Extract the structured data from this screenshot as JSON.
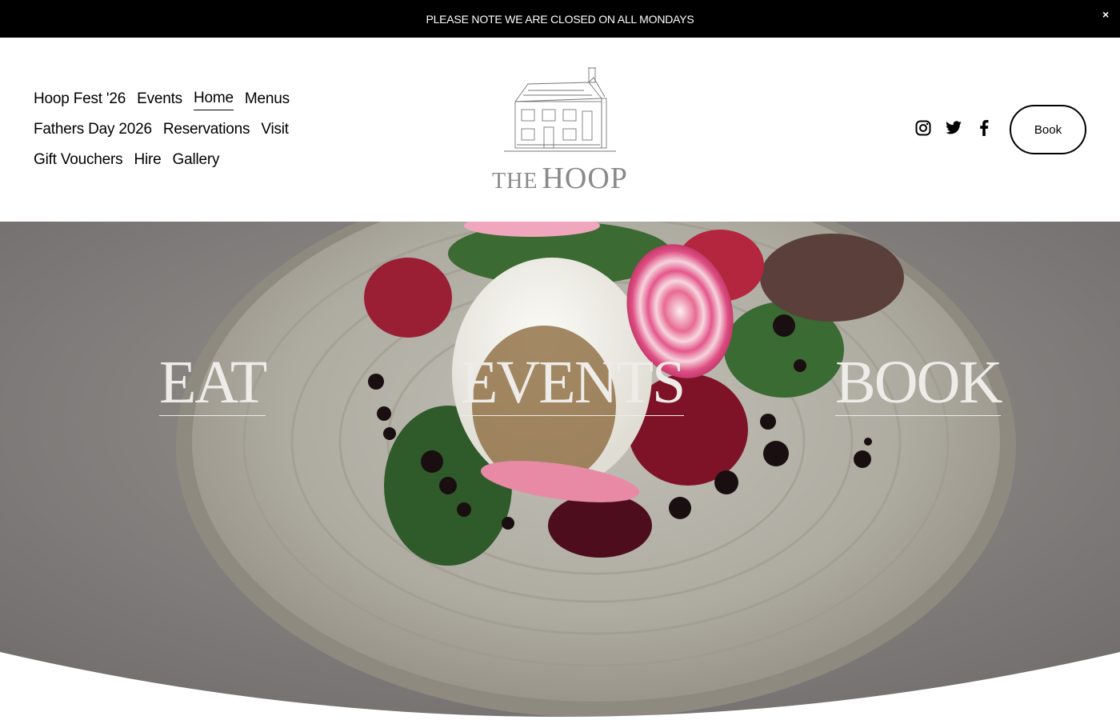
{
  "announcement": {
    "text": "PLEASE NOTE WE ARE CLOSED ON ALL MONDAYS",
    "close_label": "×"
  },
  "nav": {
    "rows": [
      [
        "Hoop Fest '26",
        "Events",
        "Home",
        "Menus"
      ],
      [
        "Fathers Day 2026",
        "Reservations",
        "Visit"
      ],
      [
        "Gift Vouchers",
        "Hire",
        "Gallery"
      ]
    ],
    "active": "Home"
  },
  "logo": {
    "the": "THE",
    "hoop": "HOOP"
  },
  "social": {
    "icons": [
      "instagram-icon",
      "twitter-icon",
      "facebook-icon"
    ]
  },
  "header": {
    "book_label": "Book"
  },
  "hero": {
    "links": [
      "EAT",
      "EVENTS",
      "BOOK"
    ],
    "text_color": "#eeece8"
  }
}
